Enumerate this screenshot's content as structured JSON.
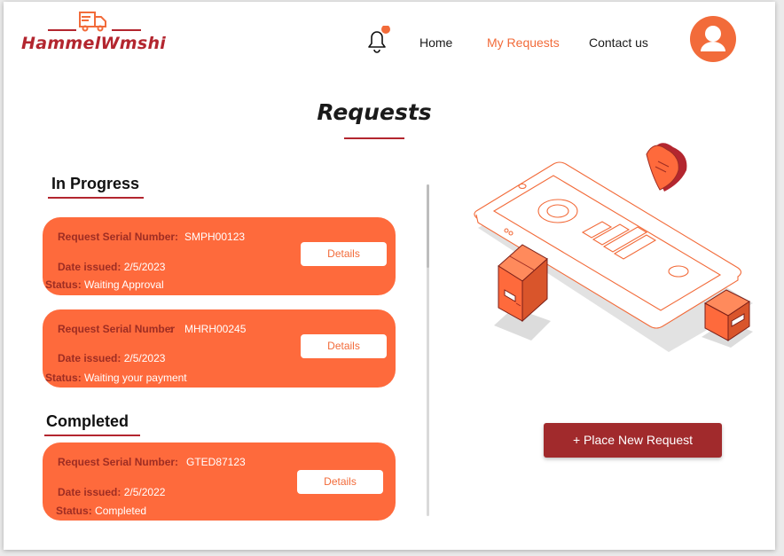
{
  "brand": {
    "name": "HammelWmshi"
  },
  "nav": {
    "home": "Home",
    "my_requests": "My Requests",
    "contact": "Contact us"
  },
  "page": {
    "title": "Requests"
  },
  "sections": {
    "in_progress": "In Progress",
    "completed": "Completed"
  },
  "labels": {
    "serial": "Request Serial Number:",
    "serial_alt": "Request Serial Number",
    "date_issued": "Date issued",
    "status": "Status",
    "details": "Details"
  },
  "requests": [
    {
      "serial": "SMPH00123",
      "date": "2/5/2023",
      "status": "Waiting Approval"
    },
    {
      "serial": "MHRH00245",
      "date": "2/5/2023",
      "status": "Waiting your payment"
    },
    {
      "serial": "GTED87123",
      "date": "2/5/2022",
      "status": "Completed"
    }
  ],
  "actions": {
    "place_new": "+ Place New Request"
  },
  "colors": {
    "accent": "#f26b3a",
    "card": "#fe6a3c",
    "brand_red": "#b3262f",
    "button_dark": "#a12a2c"
  },
  "icons": {
    "logo": "delivery-truck-icon",
    "notifications": "bell-icon",
    "profile": "user-avatar-icon"
  }
}
